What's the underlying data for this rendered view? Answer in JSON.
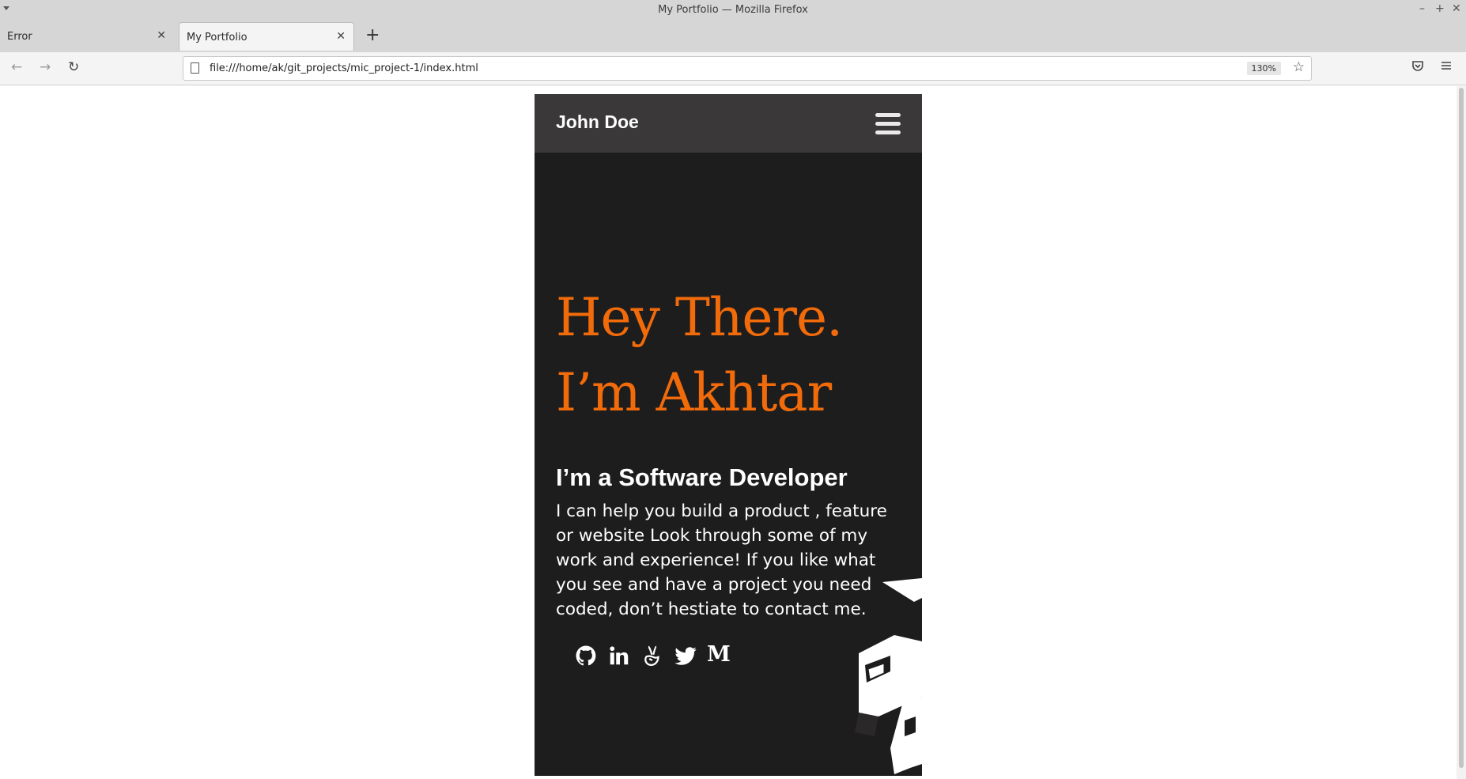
{
  "window": {
    "title": "My Portfolio — Mozilla Firefox",
    "controls": [
      "minimize",
      "maximize",
      "close"
    ]
  },
  "tabs": [
    {
      "label": "Error",
      "active": false
    },
    {
      "label": "My Portfolio",
      "active": true
    }
  ],
  "navbar": {
    "url": "file:///home/ak/git_projects/mic_project-1/index.html",
    "zoom": "130%"
  },
  "page": {
    "brand": "John Doe",
    "hero_line1": "Hey There.",
    "hero_line2": "I’m Akhtar",
    "subheading": "I’m a Software Developer",
    "bio": "I can help you build a product , feature or website Look through some of my work and experience! If you like what you see and have a project you need coded, don’t hestiate to contact me.",
    "socials": [
      "github-icon",
      "linkedin-icon",
      "angellist-icon",
      "twitter-icon",
      "medium-icon"
    ],
    "medium_letter": "M",
    "colors": {
      "accent": "#f26b0a",
      "background": "#1e1d1d",
      "nav": "#3a3838",
      "text": "#ffffff"
    }
  }
}
